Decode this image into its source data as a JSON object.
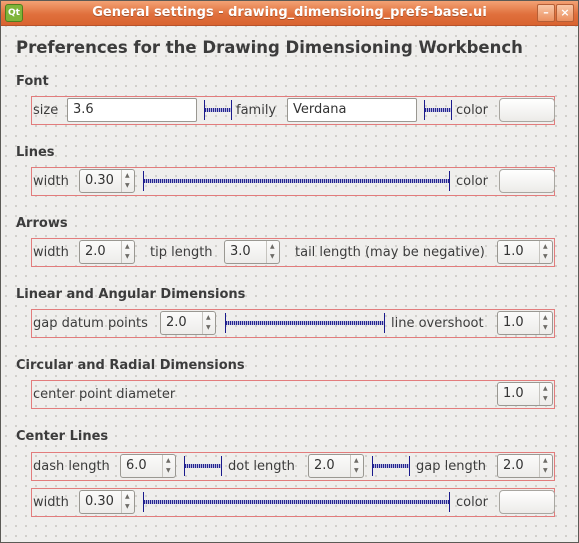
{
  "window": {
    "title": "General settings - drawing_dimensioing_prefs-base.ui",
    "app_icon_glyph": "Qt",
    "minimize_glyph": "–",
    "close_glyph": "×"
  },
  "heading": "Preferences for the Drawing Dimensioning Workbench",
  "font": {
    "section_label": "Font",
    "size_label": "size",
    "size_value": "3.6",
    "family_label": "family",
    "family_value": "Verdana",
    "color_label": "color"
  },
  "lines": {
    "section_label": "Lines",
    "width_label": "width",
    "width_value": "0.30",
    "color_label": "color"
  },
  "arrows": {
    "section_label": "Arrows",
    "width_label": "width",
    "width_value": "2.0",
    "tip_length_label": "tip length",
    "tip_length_value": "3.0",
    "tail_length_label": "tail length (may be negative)",
    "tail_length_value": "1.0"
  },
  "linear_angular": {
    "section_label": "Linear and Angular Dimensions",
    "gap_label": "gap datum points",
    "gap_value": "2.0",
    "overshoot_label": "line overshoot",
    "overshoot_value": "1.0"
  },
  "circular_radial": {
    "section_label": "Circular and Radial Dimensions",
    "center_point_label": "center point diameter",
    "center_point_value": "1.0"
  },
  "center_lines": {
    "section_label": "Center Lines",
    "dash_length_label": "dash length",
    "dash_length_value": "6.0",
    "dot_length_label": "dot length",
    "dot_length_value": "2.0",
    "gap_length_label": "gap length",
    "gap_length_value": "2.0",
    "width_label": "width",
    "width_value": "0.30",
    "color_label": "color"
  },
  "spin_up_glyph": "▲",
  "spin_down_glyph": "▼",
  "colors": {
    "titlebar": "#e0703d",
    "group_border": "#e27c7c",
    "slider": "#24248f"
  }
}
